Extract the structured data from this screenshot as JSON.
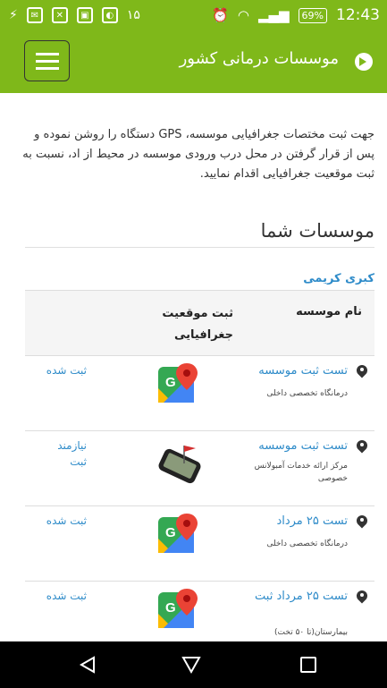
{
  "status_bar": {
    "notification_count": "۱۵",
    "battery": "69%",
    "time": "12:43"
  },
  "app_bar": {
    "title": "موسسات درمانی کشور"
  },
  "intro_text": "جهت ثبت مختصات جغرافیایی موسسه، GPS دستگاه را روشن نموده و پس از قرار گرفتن در محل درب ورودی موسسه در محیط از اد، نسبت به ثبت موقعیت جغرافیایی اقدام نمایید.",
  "section_title": "موسسات شما",
  "owner_name": "کبری کریمی",
  "table": {
    "header_name": "نام موسسه",
    "header_geo": "ثبت موقعیت جغرافیایی",
    "rows": [
      {
        "name": "تست ثبت موسسه",
        "type": "درمانگاه تخصصی داخلی",
        "icon": "google-maps-icon",
        "status": "ثبت شده"
      },
      {
        "name": "تست ثبت موسسه",
        "type": "مرکز ارائه خدمات آمبولانس خصوصی",
        "icon": "gps-phone-icon",
        "status": "نیازمند ثبت"
      },
      {
        "name": "تست ۲۵ مرداد",
        "type": "درمانگاه تخصصی داخلی",
        "icon": "google-maps-icon",
        "status": "ثبت شده"
      },
      {
        "name": "تست ۲۵ مرداد ثبت",
        "type": "بیمارستان(تا ۵۰ تخت)",
        "icon": "google-maps-icon",
        "status": "ثبت شده"
      }
    ]
  },
  "colors": {
    "accent": "#7fb81a",
    "link": "#2e8bc9"
  }
}
